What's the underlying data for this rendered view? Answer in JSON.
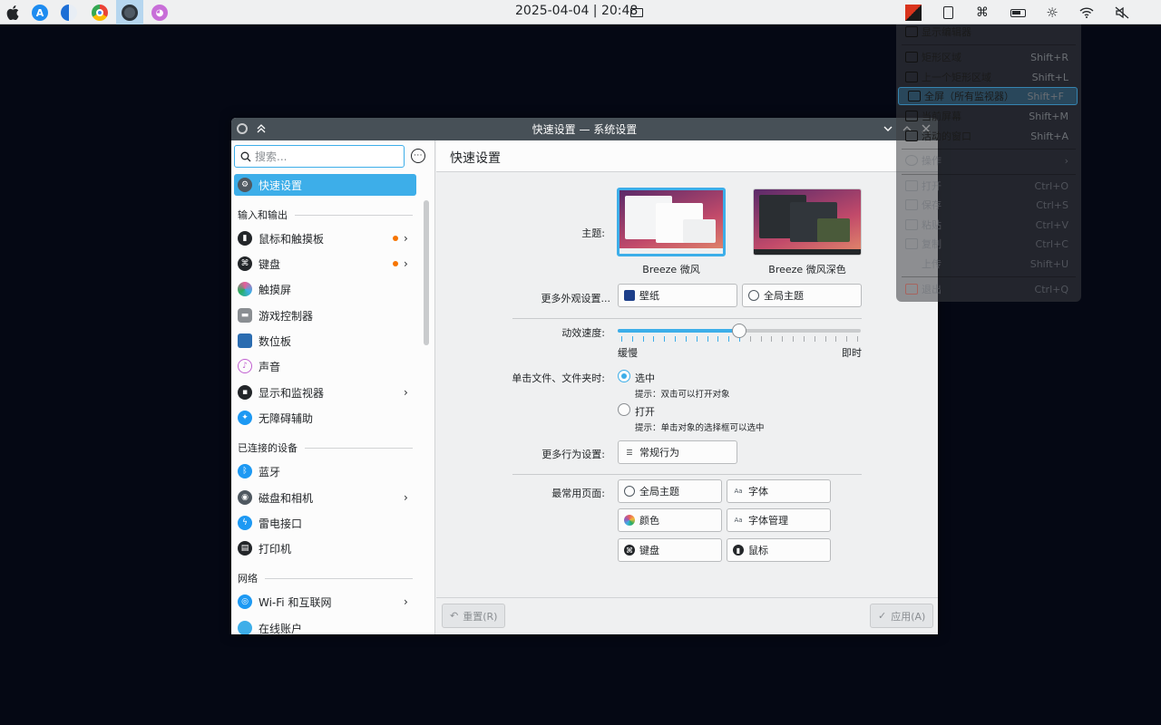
{
  "topbar": {
    "clock": "2025-04-04 | 20:48"
  },
  "context_menu": {
    "items": [
      {
        "label": "显示编辑器",
        "shortcut": ""
      },
      {
        "label": "矩形区域",
        "shortcut": "Shift+R"
      },
      {
        "label": "上一个矩形区域",
        "shortcut": "Shift+L"
      },
      {
        "label": "全屏（所有监视器）",
        "shortcut": "Shift+F"
      },
      {
        "label": "当前屏幕",
        "shortcut": "Shift+M"
      },
      {
        "label": "活动的窗口",
        "shortcut": "Shift+A"
      },
      {
        "label": "操作",
        "shortcut": ""
      },
      {
        "label": "打开",
        "shortcut": "Ctrl+O"
      },
      {
        "label": "保存",
        "shortcut": "Ctrl+S"
      },
      {
        "label": "粘贴",
        "shortcut": "Ctrl+V"
      },
      {
        "label": "复制",
        "shortcut": "Ctrl+C"
      },
      {
        "label": "上传",
        "shortcut": "Shift+U"
      },
      {
        "label": "退出",
        "shortcut": "Ctrl+Q"
      }
    ]
  },
  "window": {
    "title": "快速设置 — 系统设置"
  },
  "sidebar": {
    "search_placeholder": "搜索...",
    "selected": "快速设置",
    "cat_io": "输入和输出",
    "cat_devices": "已连接的设备",
    "cat_network": "网络",
    "items": [
      {
        "label": "鼠标和触摸板"
      },
      {
        "label": "键盘"
      },
      {
        "label": "触摸屏"
      },
      {
        "label": "游戏控制器"
      },
      {
        "label": "数位板"
      },
      {
        "label": "声音"
      },
      {
        "label": "显示和监视器"
      },
      {
        "label": "无障碍辅助"
      },
      {
        "label": "蓝牙"
      },
      {
        "label": "磁盘和相机"
      },
      {
        "label": "雷电接口"
      },
      {
        "label": "打印机"
      },
      {
        "label": "Wi-Fi 和互联网"
      },
      {
        "label": "在线账户"
      }
    ]
  },
  "page": {
    "title": "快速设置",
    "theme_label": "主题:",
    "theme_light": "Breeze 微风",
    "theme_dark": "Breeze 微风深色",
    "more_appearance_label": "更多外观设置...",
    "wallpaper_btn": "壁纸",
    "global_theme_btn": "全局主题",
    "anim_label": "动效速度:",
    "anim_slow": "缓慢",
    "anim_fast": "即时",
    "anim_value": 0.5,
    "click_label": "单击文件、文件夹时:",
    "opt_select": "选中",
    "opt_select_hint": "提示：双击可以打开对象",
    "opt_open": "打开",
    "opt_open_hint": "提示：单击对象的选择框可以选中",
    "more_behavior_label": "更多行为设置:",
    "general_behavior_btn": "常规行为",
    "frequent_label": "最常用页面:",
    "frequent": [
      "全局主题",
      "字体",
      "颜色",
      "字体管理",
      "键盘",
      "鼠标"
    ],
    "reset_btn": "重置(R)",
    "apply_btn": "应用(A)"
  }
}
